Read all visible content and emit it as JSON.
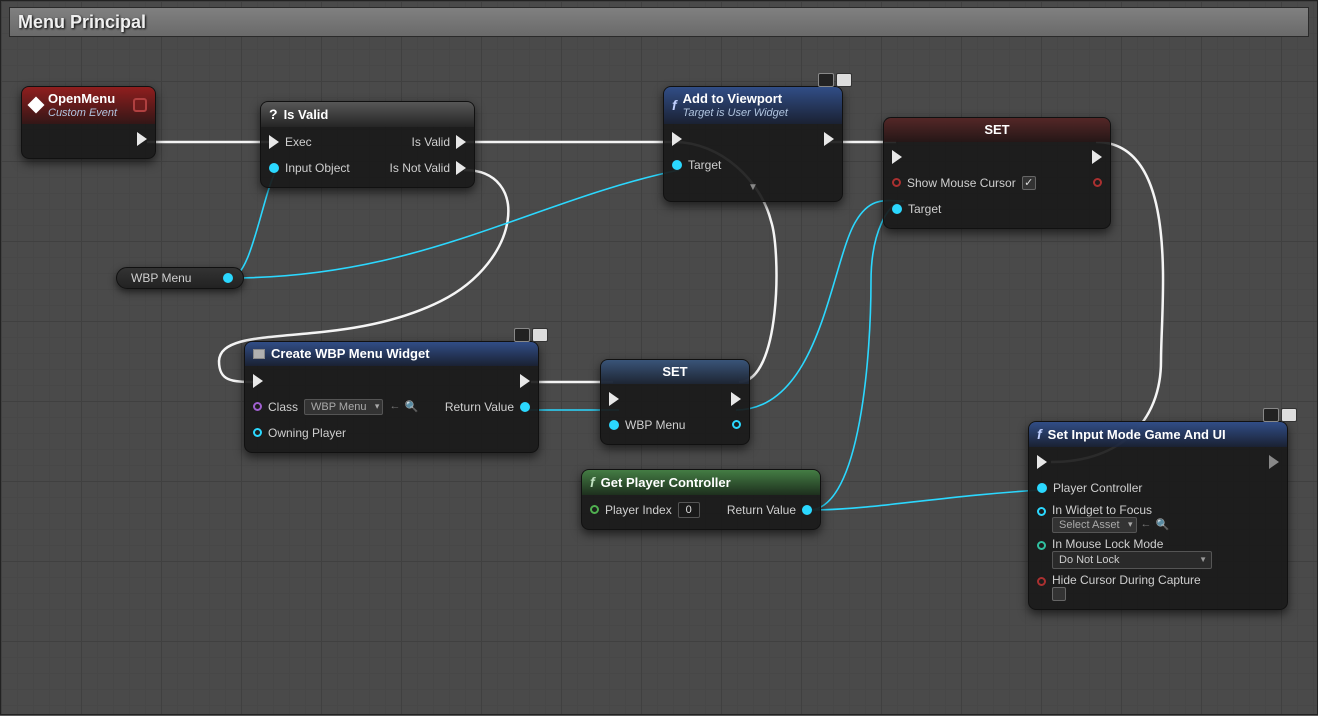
{
  "title": "Menu Principal",
  "var_pill": {
    "label": "WBP Menu"
  },
  "nodes": {
    "openmenu": {
      "title": "OpenMenu",
      "subtitle": "Custom Event"
    },
    "isvalid": {
      "title": "Is Valid",
      "pins": {
        "exec": "Exec",
        "input_object": "Input Object",
        "valid": "Is Valid",
        "not_valid": "Is Not Valid"
      }
    },
    "addviewport": {
      "title": "Add to Viewport",
      "subtitle": "Target is User Widget",
      "pins": {
        "target": "Target"
      }
    },
    "set_cursor": {
      "title": "SET",
      "pins": {
        "show_cursor": "Show Mouse Cursor",
        "target": "Target"
      }
    },
    "create_widget": {
      "title": "Create WBP Menu Widget",
      "pins": {
        "class": "Class",
        "class_value": "WBP Menu",
        "owning": "Owning Player",
        "return": "Return Value"
      }
    },
    "set_wbp": {
      "title": "SET",
      "pins": {
        "wbp": "WBP Menu"
      }
    },
    "get_controller": {
      "title": "Get Player Controller",
      "pins": {
        "player_index": "Player Index",
        "index_value": "0",
        "return": "Return Value"
      }
    },
    "set_input_mode": {
      "title": "Set Input Mode Game And UI",
      "pins": {
        "player_controller": "Player Controller",
        "widget_focus": "In Widget to Focus",
        "widget_focus_value": "Select Asset",
        "lock_mode": "In Mouse Lock Mode",
        "lock_mode_value": "Do Not Lock",
        "hide_cursor": "Hide Cursor During Capture"
      }
    }
  }
}
